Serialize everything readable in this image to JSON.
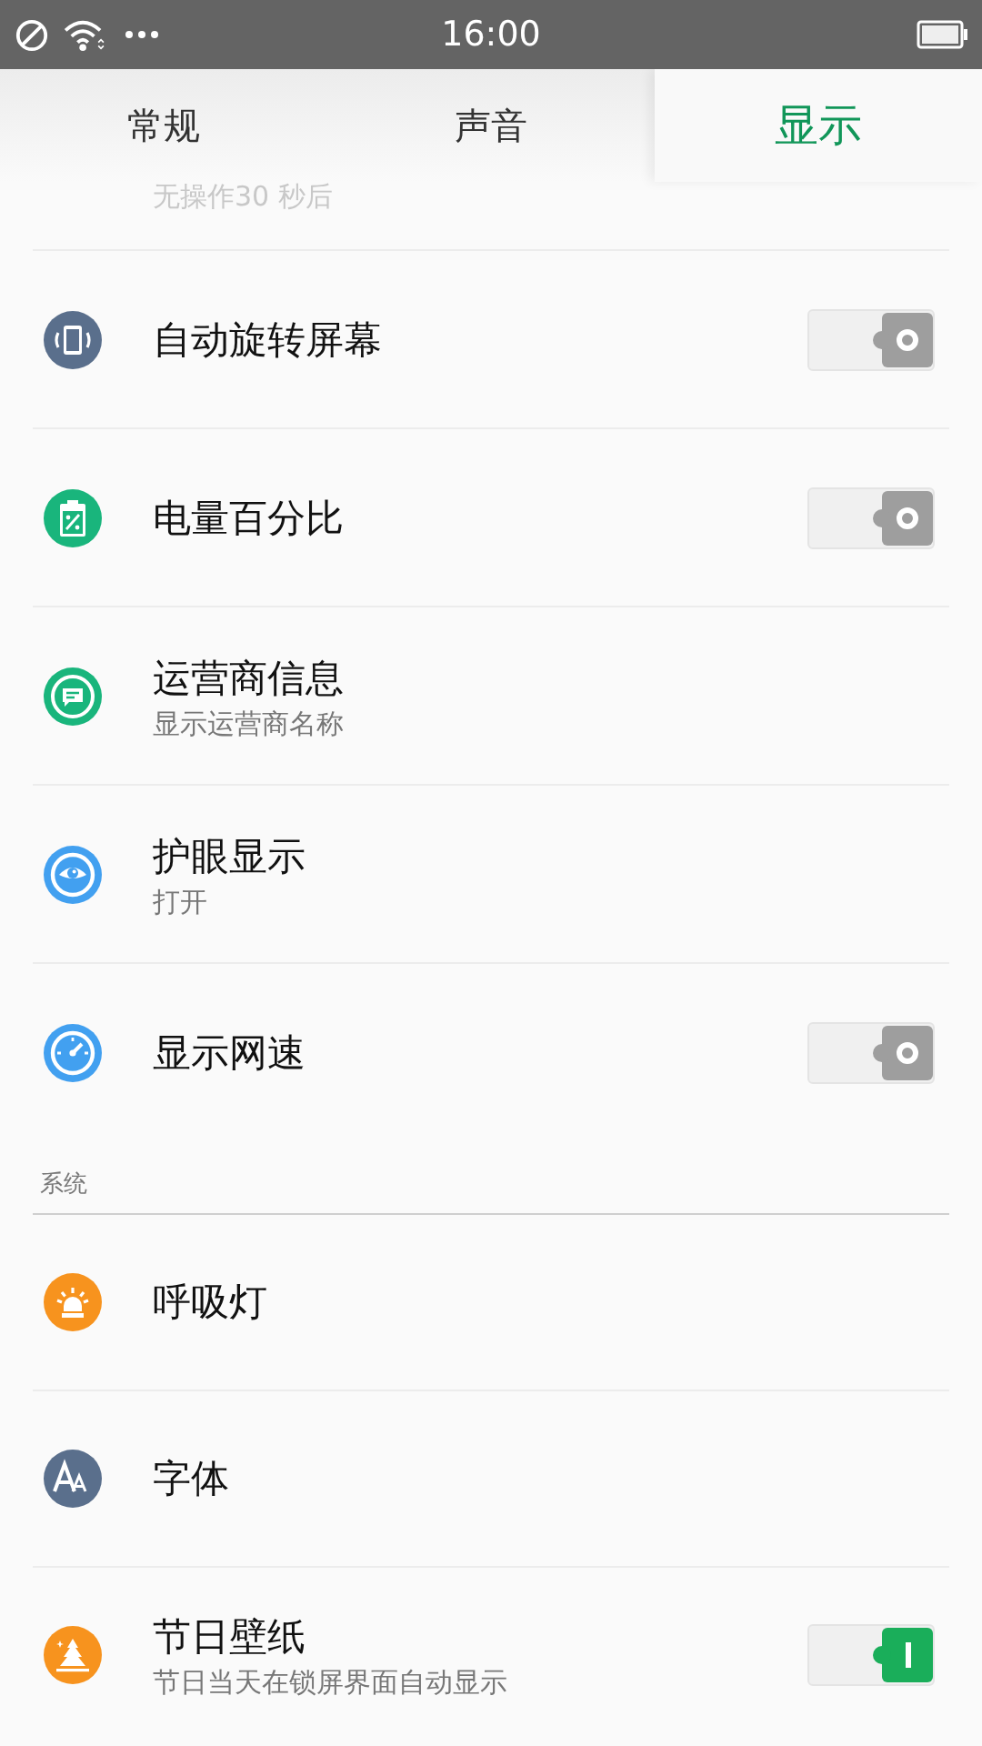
{
  "status_bar": {
    "time": "16:00"
  },
  "tabs": [
    {
      "label": "常规",
      "selected": false
    },
    {
      "label": "声音",
      "selected": false
    },
    {
      "label": "显示",
      "selected": true
    }
  ],
  "clipped_subtitle": "无操作30 秒后",
  "groups": [
    {
      "items": [
        {
          "kind": "toggle",
          "title": "自动旋转屏幕",
          "on": false
        },
        {
          "kind": "toggle",
          "title": "电量百分比",
          "on": false
        },
        {
          "kind": "link",
          "title": "运营商信息",
          "subtitle": "显示运营商名称"
        },
        {
          "kind": "link",
          "title": "护眼显示",
          "subtitle": "打开"
        },
        {
          "kind": "toggle",
          "title": "显示网速",
          "on": false
        }
      ]
    },
    {
      "header": "系统",
      "items": [
        {
          "kind": "link",
          "title": "呼吸灯"
        },
        {
          "kind": "link",
          "title": "字体"
        },
        {
          "kind": "toggle",
          "title": "节日壁纸",
          "subtitle": "节日当天在锁屏界面自动显示",
          "on": true
        }
      ]
    }
  ]
}
